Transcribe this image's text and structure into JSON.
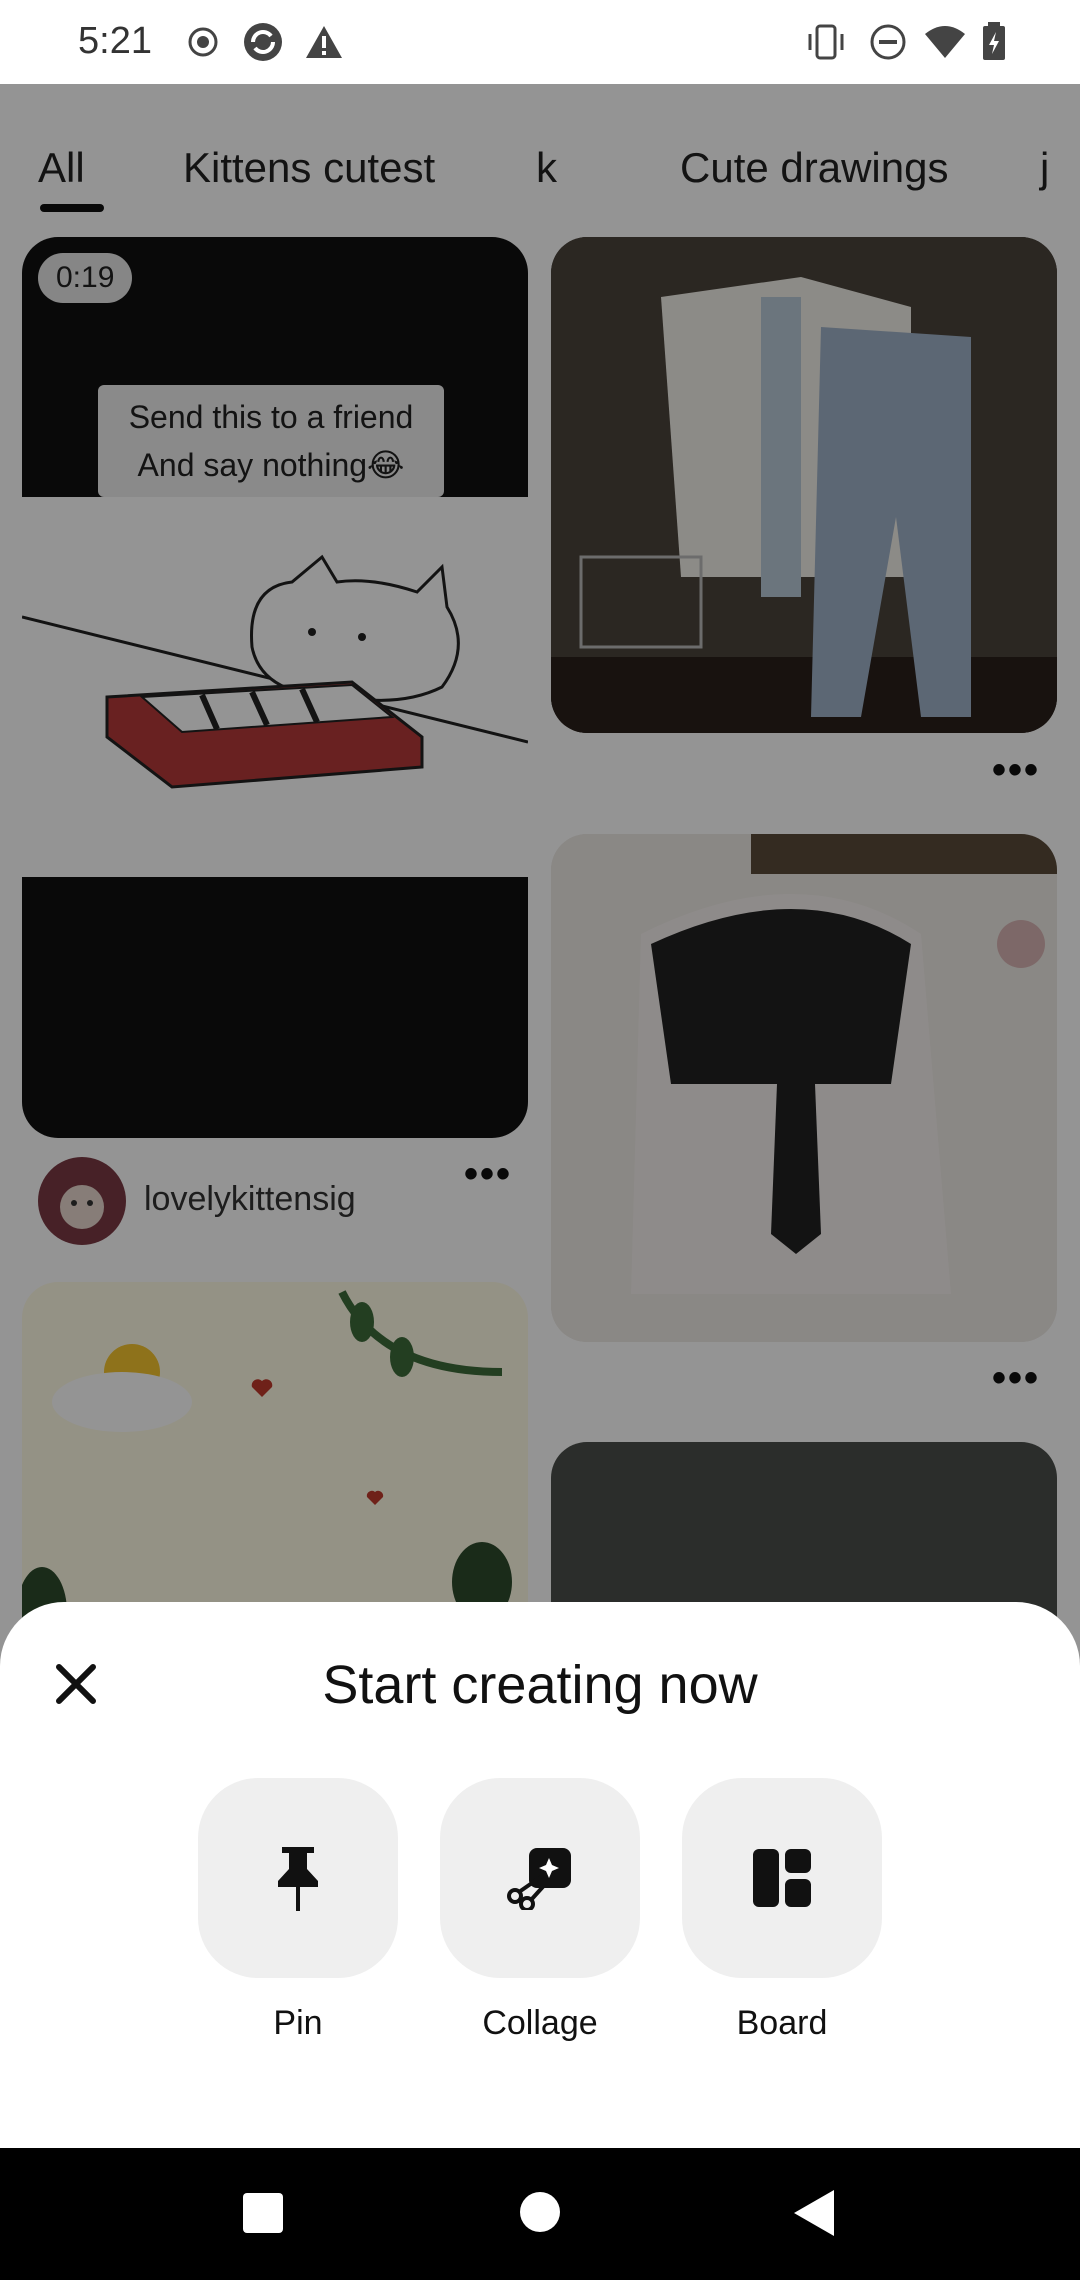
{
  "status_bar": {
    "time": "5:21",
    "left_icons": [
      "record-icon",
      "sync-icon",
      "warning-icon"
    ],
    "right_icons": [
      "vibrate-icon",
      "do-not-disturb-icon",
      "wifi-icon",
      "battery-charging-icon"
    ]
  },
  "feed": {
    "tabs": [
      {
        "label": "All",
        "active": true
      },
      {
        "label": "Kittens cutest",
        "active": false
      },
      {
        "label": "k",
        "active": false
      },
      {
        "label": "Cute drawings",
        "active": false
      },
      {
        "label": "j",
        "active": false
      }
    ],
    "video_pin": {
      "duration": "0:19",
      "caption_line1": "Send this to a friend",
      "caption_line2": "And say nothing😂"
    },
    "author": {
      "name": "lovelykittensig"
    },
    "more_label": "•••"
  },
  "sheet": {
    "title": "Start creating now",
    "close_icon": "close-icon",
    "options": [
      {
        "label": "Pin",
        "icon": "pushpin-icon"
      },
      {
        "label": "Collage",
        "icon": "collage-scissors-icon"
      },
      {
        "label": "Board",
        "icon": "board-icon"
      }
    ]
  },
  "nav_bar": {
    "buttons": [
      "recents-square-icon",
      "home-circle-icon",
      "back-triangle-icon"
    ]
  }
}
